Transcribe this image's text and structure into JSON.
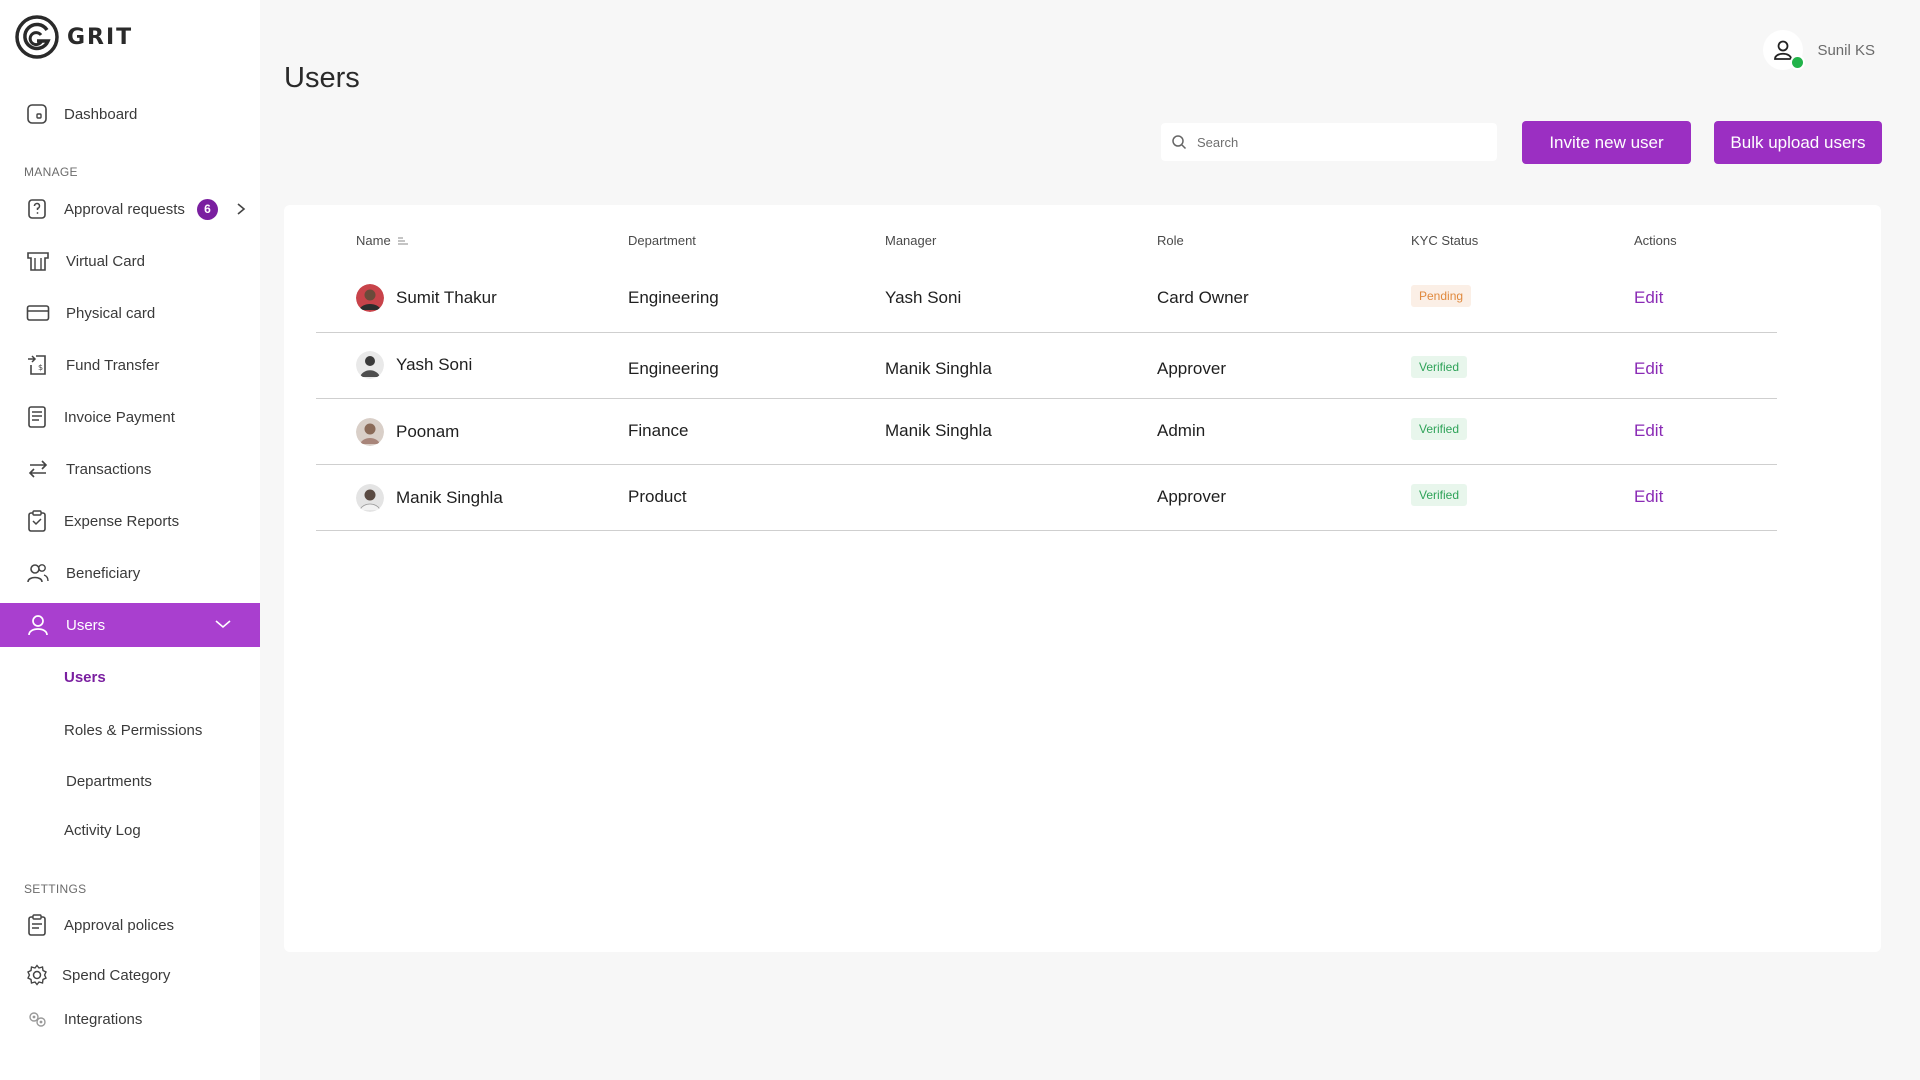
{
  "brand": {
    "name": "GRIT"
  },
  "sidebar": {
    "dashboard": "Dashboard",
    "manage_label": "MANAGE",
    "manage_items": [
      {
        "label": "Approval requests",
        "badge": "6",
        "icon": "question-doc-icon"
      },
      {
        "label": "Virtual Card",
        "icon": "virtual-card-icon"
      },
      {
        "label": "Physical card",
        "icon": "credit-card-icon"
      },
      {
        "label": "Fund Transfer",
        "icon": "fund-transfer-icon"
      },
      {
        "label": "Invoice Payment",
        "icon": "invoice-icon"
      },
      {
        "label": "Transactions",
        "icon": "transactions-icon"
      },
      {
        "label": "Expense Reports",
        "icon": "clipboard-icon"
      },
      {
        "label": "Beneficiary",
        "icon": "people-icon"
      },
      {
        "label": "Users",
        "icon": "user-icon"
      }
    ],
    "users_submenu": [
      "Users",
      "Roles & Permissions",
      "Departments",
      "Activity Log"
    ],
    "settings_label": "SETTINGS",
    "settings_items": [
      {
        "label": "Approval polices",
        "icon": "clipboard-check-icon"
      },
      {
        "label": "Spend Category",
        "icon": "gear-icon"
      },
      {
        "label": "Integrations",
        "icon": "integrations-icon"
      }
    ]
  },
  "header": {
    "title": "Users",
    "user_name": "Sunil KS",
    "search_placeholder": "Search",
    "invite_button": "Invite new user",
    "bulk_button": "Bulk upload users"
  },
  "table": {
    "columns": [
      "Name",
      "Department",
      "Manager",
      "Role",
      "KYC Status",
      "Actions"
    ],
    "rows": [
      {
        "name": "Sumit Thakur",
        "department": "Engineering",
        "manager": "Yash Soni",
        "role": "Card Owner",
        "kyc": "Pending",
        "action": "Edit"
      },
      {
        "name": "Yash Soni",
        "department": "Engineering",
        "manager": "Manik Singhla",
        "role": "Approver",
        "kyc": "Verified",
        "action": "Edit"
      },
      {
        "name": "Poonam",
        "department": "Finance",
        "manager": "Manik Singhla",
        "role": "Admin",
        "kyc": "Verified",
        "action": "Edit"
      },
      {
        "name": "Manik Singhla",
        "department": "Product",
        "manager": "",
        "role": "Approver",
        "kyc": "Verified",
        "action": "Edit"
      }
    ]
  },
  "colors": {
    "accent": "#9b2fc2",
    "active_nav": "#a93fcf",
    "badge": "#7a1fa0",
    "pending": "#e0893d",
    "verified": "#2fa359"
  }
}
